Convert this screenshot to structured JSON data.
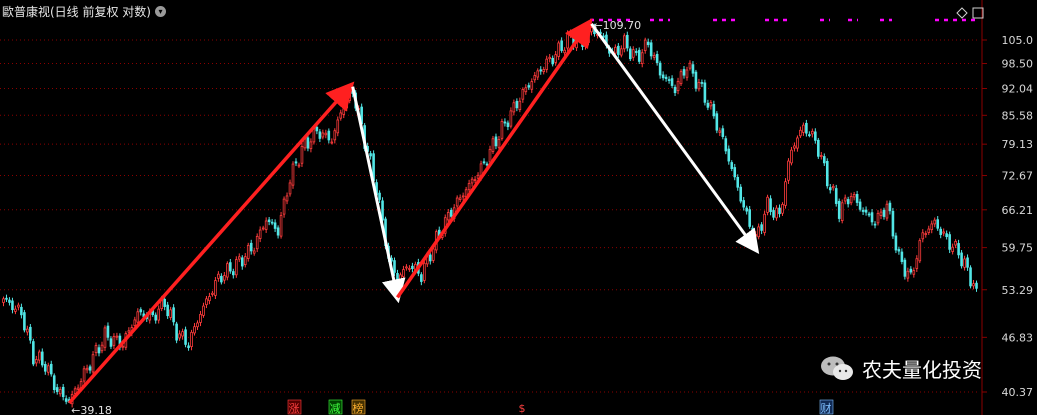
{
  "header": {
    "title": "歐普康视(日线 前复权 对数)",
    "dropdown_glyph": "▾",
    "corner_icons": [
      "diamond-icon",
      "window-icon"
    ]
  },
  "watermark": {
    "text": "农夫量化投资",
    "icon": "wechat-icon"
  },
  "colors": {
    "background": "#000000",
    "up_candle": "#ff3c3c",
    "down_candle": "#52e6e6",
    "grid": "#8b0000",
    "axis_text": "#d8d8d8",
    "red_arrow": "#ff2020",
    "white_arrow": "#ffffff",
    "markers": "#ff00ff"
  },
  "event_badges": [
    {
      "label": "涨",
      "color": "#ff4040",
      "bg": "#550000"
    },
    {
      "label": "减",
      "color": "#40ff40",
      "bg": "#004400"
    },
    {
      "label": "榜",
      "color": "#ffb030",
      "bg": "#443000"
    },
    {
      "label": "$",
      "color": "#ff4040",
      "bg": "transparent"
    },
    {
      "label": "财",
      "color": "#80c0ff",
      "bg": "#102a55"
    }
  ],
  "chart_data": {
    "type": "candlestick",
    "scale": "log",
    "y_ticks": [
      "105.0",
      "98.50",
      "92.04",
      "85.58",
      "79.13",
      "72.67",
      "66.21",
      "59.75",
      "53.29",
      "46.83",
      "40.37"
    ],
    "ylim": [
      40.37,
      105.0
    ],
    "grid": true,
    "annotations": [
      {
        "label": "39.18",
        "value": 39.18,
        "type": "low"
      },
      {
        "label": "109.70",
        "value": 109.7,
        "type": "high"
      }
    ],
    "zigzag": [
      {
        "label": "up",
        "from": 39.18,
        "to": 92.5,
        "color": "red"
      },
      {
        "label": "down",
        "from": 92.5,
        "to": 52.2,
        "color": "white"
      },
      {
        "label": "up",
        "from": 52.2,
        "to": 109.7,
        "color": "red"
      },
      {
        "label": "down",
        "from": 109.7,
        "to": 59.5,
        "color": "white"
      }
    ],
    "anchors": [
      {
        "i": 0,
        "v": 52
      },
      {
        "i": 6,
        "v": 50
      },
      {
        "i": 10,
        "v": 44.5
      },
      {
        "i": 14,
        "v": 43.5
      },
      {
        "i": 18,
        "v": 40.5
      },
      {
        "i": 22,
        "v": 39.3
      },
      {
        "i": 28,
        "v": 43
      },
      {
        "i": 34,
        "v": 47
      },
      {
        "i": 40,
        "v": 46
      },
      {
        "i": 45,
        "v": 50
      },
      {
        "i": 50,
        "v": 49.5
      },
      {
        "i": 54,
        "v": 51.5
      },
      {
        "i": 58,
        "v": 47.5
      },
      {
        "i": 62,
        "v": 46
      },
      {
        "i": 66,
        "v": 50
      },
      {
        "i": 72,
        "v": 55
      },
      {
        "i": 78,
        "v": 57
      },
      {
        "i": 84,
        "v": 60
      },
      {
        "i": 88,
        "v": 64.5
      },
      {
        "i": 92,
        "v": 62.5
      },
      {
        "i": 96,
        "v": 72
      },
      {
        "i": 100,
        "v": 78
      },
      {
        "i": 105,
        "v": 82
      },
      {
        "i": 110,
        "v": 80
      },
      {
        "i": 114,
        "v": 88
      },
      {
        "i": 117,
        "v": 91.5
      },
      {
        "i": 121,
        "v": 80
      },
      {
        "i": 125,
        "v": 70
      },
      {
        "i": 129,
        "v": 58
      },
      {
        "i": 132,
        "v": 55
      },
      {
        "i": 136,
        "v": 57
      },
      {
        "i": 140,
        "v": 55.5
      },
      {
        "i": 145,
        "v": 61
      },
      {
        "i": 150,
        "v": 66
      },
      {
        "i": 155,
        "v": 70
      },
      {
        "i": 160,
        "v": 74
      },
      {
        "i": 165,
        "v": 80
      },
      {
        "i": 170,
        "v": 86
      },
      {
        "i": 175,
        "v": 92
      },
      {
        "i": 180,
        "v": 97
      },
      {
        "i": 185,
        "v": 101
      },
      {
        "i": 190,
        "v": 106
      },
      {
        "i": 194,
        "v": 104
      },
      {
        "i": 197,
        "v": 108
      },
      {
        "i": 200,
        "v": 106.5
      },
      {
        "i": 204,
        "v": 101
      },
      {
        "i": 208,
        "v": 104
      },
      {
        "i": 212,
        "v": 100
      },
      {
        "i": 216,
        "v": 104
      },
      {
        "i": 220,
        "v": 96
      },
      {
        "i": 225,
        "v": 92
      },
      {
        "i": 229,
        "v": 98
      },
      {
        "i": 233,
        "v": 93
      },
      {
        "i": 237,
        "v": 87
      },
      {
        "i": 241,
        "v": 80
      },
      {
        "i": 245,
        "v": 72
      },
      {
        "i": 249,
        "v": 65
      },
      {
        "i": 252,
        "v": 61
      },
      {
        "i": 256,
        "v": 67
      },
      {
        "i": 260,
        "v": 65
      },
      {
        "i": 264,
        "v": 78
      },
      {
        "i": 268,
        "v": 83
      },
      {
        "i": 272,
        "v": 80
      },
      {
        "i": 276,
        "v": 72
      },
      {
        "i": 280,
        "v": 66
      },
      {
        "i": 284,
        "v": 69
      },
      {
        "i": 288,
        "v": 66
      },
      {
        "i": 292,
        "v": 64
      },
      {
        "i": 296,
        "v": 67
      },
      {
        "i": 300,
        "v": 58
      },
      {
        "i": 304,
        "v": 55
      },
      {
        "i": 308,
        "v": 62
      },
      {
        "i": 312,
        "v": 64
      },
      {
        "i": 316,
        "v": 61
      },
      {
        "i": 320,
        "v": 59
      },
      {
        "i": 324,
        "v": 55
      },
      {
        "i": 326,
        "v": 53.5
      }
    ]
  }
}
